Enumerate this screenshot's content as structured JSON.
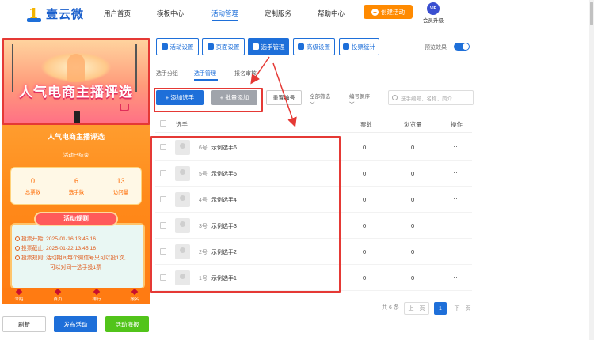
{
  "brand": {
    "name": "壹云微"
  },
  "nav": {
    "items": [
      "用户首页",
      "模板中心",
      "活动管理",
      "定制服务",
      "帮助中心"
    ],
    "create_label": "创建活动",
    "vip_badge": "VIP",
    "vip_label": "会员升级"
  },
  "preview": {
    "banner_title": "人气电商主播评选",
    "activity_title": "人气电商主播评选",
    "status": "活动已结束",
    "stats": [
      {
        "value": "0",
        "label": "总票数"
      },
      {
        "value": "6",
        "label": "选手数"
      },
      {
        "value": "13",
        "label": "访问量"
      }
    ],
    "rules_title": "活动规则",
    "rules": [
      "投票开始: 2025-01-16 13:45:16",
      "投票截止: 2025-01-22 13:45:16",
      "投票规则: 活动期间每个微信号只可以投1次,",
      "可以对同一选手投1票"
    ],
    "tabbar": [
      "介绍",
      "首页",
      "排行",
      "报名"
    ]
  },
  "left_actions": {
    "refresh": "刷新",
    "publish": "发布活动",
    "poster": "活动海报"
  },
  "toolbar": {
    "buttons": [
      "活动设置",
      "页面设置",
      "选手管理",
      "高级设置",
      "投票统计"
    ],
    "preview_label": "预览效果"
  },
  "subtabs": [
    "选手分组",
    "选手管理",
    "报名审核"
  ],
  "actions": {
    "add": "添加选手",
    "batch": "批量添加",
    "renumber": "重置编号",
    "filter_all": "全部筛选",
    "sort": "编号倒序",
    "search_placeholder": "选手编号、名称、简介"
  },
  "table": {
    "headers": [
      "选手",
      "票数",
      "浏览量",
      "操作"
    ],
    "rows": [
      {
        "no": "6号",
        "name": "示例选手6",
        "votes": "0",
        "views": "0"
      },
      {
        "no": "5号",
        "name": "示例选手5",
        "votes": "0",
        "views": "0"
      },
      {
        "no": "4号",
        "name": "示例选手4",
        "votes": "0",
        "views": "0"
      },
      {
        "no": "3号",
        "name": "示例选手3",
        "votes": "0",
        "views": "0"
      },
      {
        "no": "2号",
        "name": "示例选手2",
        "votes": "0",
        "views": "0"
      },
      {
        "no": "1号",
        "name": "示例选手1",
        "votes": "0",
        "views": "0"
      }
    ],
    "more": "···"
  },
  "pagination": {
    "total": "共 6 条",
    "prev": "上一页",
    "current": "1",
    "next": "下一页"
  },
  "colors": {
    "primary": "#1e6fd9",
    "accent": "#ff8a00",
    "highlight": "#e53935",
    "success": "#52c41a"
  }
}
